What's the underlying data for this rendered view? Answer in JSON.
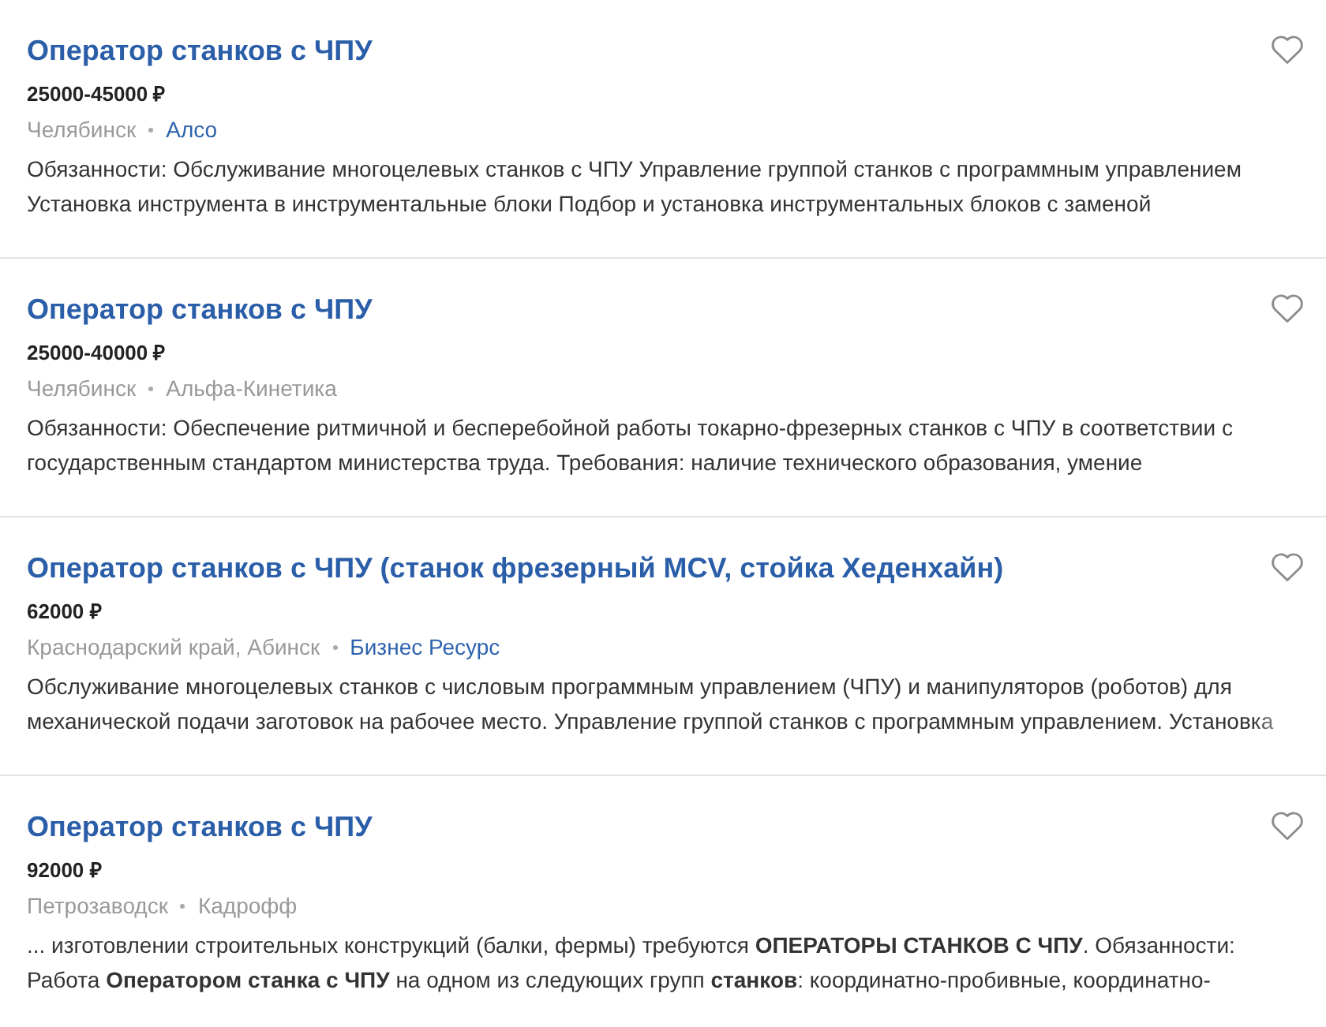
{
  "vacancies": [
    {
      "title": "Оператор станков с ЧПУ",
      "salary": "25000-45000 ₽",
      "location": "Челябинск",
      "company": {
        "name": "Алсо",
        "link": true
      },
      "description": "Обязанности: Обслуживание многоцелевых станков с ЧПУ Управление группой станков с программным управлением Установка инструмента в инструментальные блоки Подбор и установка инструментальных блоков с заменой",
      "saved": false
    },
    {
      "title": "Оператор станков с ЧПУ",
      "salary": "25000-40000 ₽",
      "location": "Челябинск",
      "company": {
        "name": "Альфа-Кинетика",
        "link": false
      },
      "description": "Обязанности: Обеспечение ритмичной и бесперебойной работы токарно-фрезерных станков с ЧПУ в соответствии с государственным стандартом министерства труда. Требования: наличие технического образования, умение",
      "saved": false
    },
    {
      "title": "Оператор станков с ЧПУ (станок фрезерный MCV, стойка Хеденхайн)",
      "salary": "62000 ₽",
      "location": "Краснодарский край, Абинск",
      "company": {
        "name": "Бизнес Ресурс",
        "link": true
      },
      "description": "Обслуживание многоцелевых станков с числовым программным управлением (ЧПУ) и манипуляторов (роботов) для механической подачи заготовок на рабочее место. Управление группой станков с программным управлением. Установка",
      "saved": false
    },
    {
      "title": "Оператор станков с ЧПУ",
      "salary": "92000 ₽",
      "location": "Петрозаводск",
      "company": {
        "name": "Кадрофф",
        "link": false
      },
      "description": "... изготовлении строительных конструкций (балки, фермы) требуются **ОПЕРАТОРЫ СТАНКОВ С ЧПУ**. Обязанности: Работа **Оператором станка с ЧПУ** на одном из следующих групп **станков**: координатно-пробивные, координатно-",
      "saved": false
    }
  ]
}
